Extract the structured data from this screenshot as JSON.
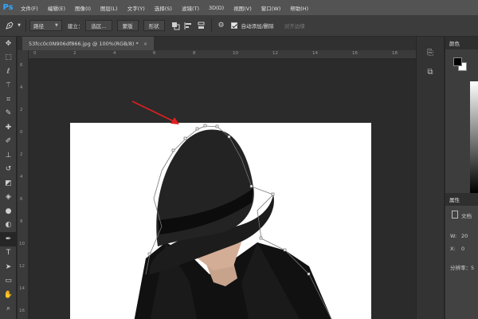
{
  "app": {
    "logo": "Ps"
  },
  "menu": [
    "文件(F)",
    "编辑(E)",
    "图像(I)",
    "图层(L)",
    "文字(Y)",
    "选择(S)",
    "滤镜(T)",
    "3D(D)",
    "视图(V)",
    "窗口(W)",
    "帮助(H)"
  ],
  "options": {
    "mode_value": "路径",
    "build_label": "建立：",
    "selection_btn": "选区...",
    "mask_btn": "蒙版",
    "shape_btn": "形状",
    "auto_add_delete_label": "自动添加/删除",
    "align_edges_label": "对齐边缘"
  },
  "document": {
    "tab_title": "53fcc0c0N906df866.jpg @ 100%(RGB/8) *",
    "close_glyph": "×"
  },
  "rulers": {
    "top": [
      "0",
      "2",
      "4",
      "6",
      "8",
      "10",
      "12",
      "14",
      "16",
      "18"
    ],
    "left": [
      "6",
      "4",
      "2",
      "0",
      "2",
      "4",
      "6",
      "8",
      "10",
      "12",
      "14",
      "16"
    ]
  },
  "panels": {
    "color_tab": "颜色",
    "properties_tab": "属性",
    "doc_label": "文档",
    "width_label": "W:",
    "width_value": "20",
    "x_label": "X:",
    "x_value": "0",
    "resolution_label": "分辨率：5"
  },
  "colors": {
    "foreground": "#000000",
    "background": "#ffffff",
    "annotation_arrow": "#e02020",
    "brand": "#31a8ff"
  },
  "icons": {
    "toolbar": [
      "move-icon",
      "marquee-icon",
      "lasso-icon",
      "magic-wand-icon",
      "crop-icon",
      "eyedropper-icon",
      "healing-brush-icon",
      "brush-icon",
      "clone-stamp-icon",
      "history-brush-icon",
      "eraser-icon",
      "paint-bucket-icon",
      "blur-icon",
      "dodge-icon",
      "pen-icon",
      "type-icon",
      "path-selection-icon",
      "rectangle-icon",
      "hand-icon",
      "zoom-icon"
    ]
  }
}
